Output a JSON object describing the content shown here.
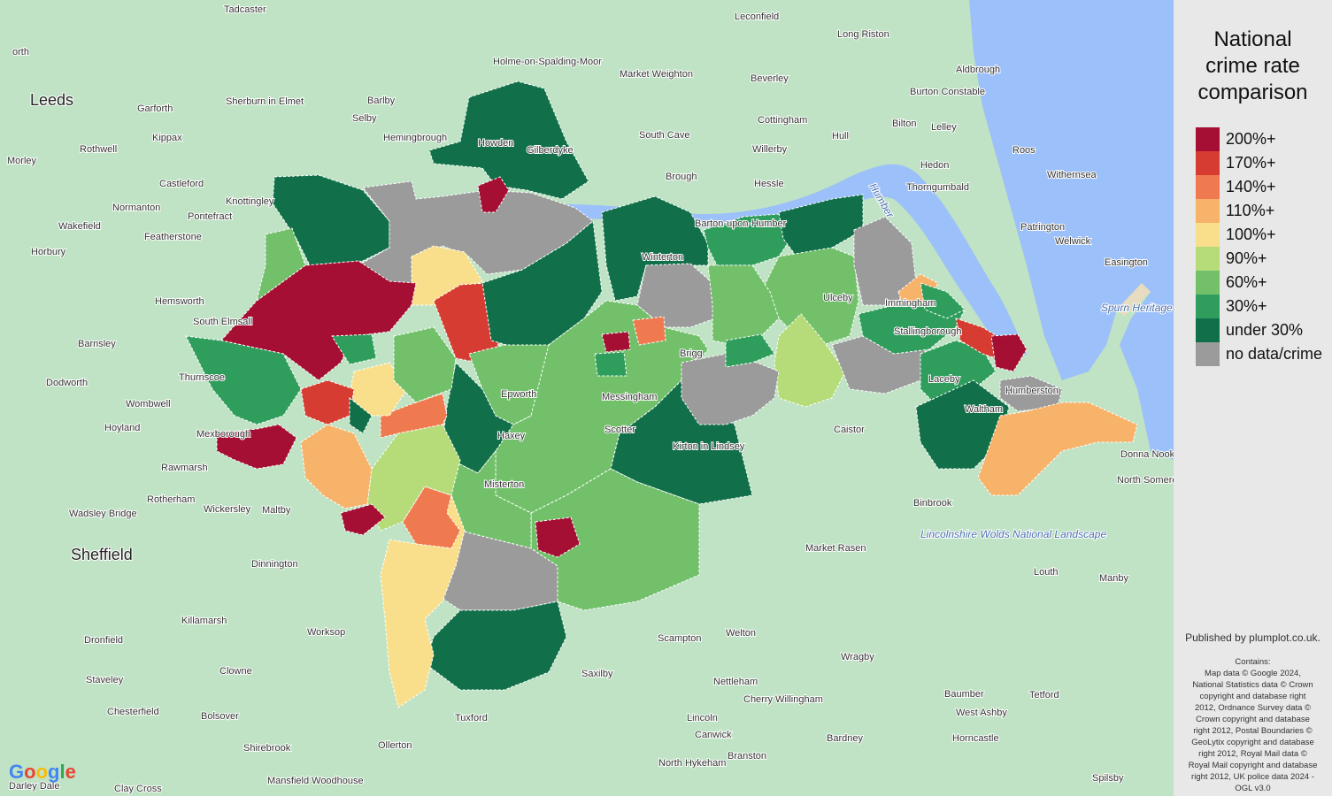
{
  "legend": {
    "title_lines": [
      "National",
      "crime rate",
      "comparison"
    ],
    "items": [
      {
        "label": "200%+",
        "color": "#a50f34"
      },
      {
        "label": "170%+",
        "color": "#d73c32"
      },
      {
        "label": "140%+",
        "color": "#f07a4f"
      },
      {
        "label": "110%+",
        "color": "#f8b36b"
      },
      {
        "label": "100%+",
        "color": "#f9df8c"
      },
      {
        "label": "90%+",
        "color": "#b5dc78"
      },
      {
        "label": "60%+",
        "color": "#73c06b"
      },
      {
        "label": "30%+",
        "color": "#2f9e5c"
      },
      {
        "label": "under 30%",
        "color": "#11704a"
      },
      {
        "label": "no data/crime",
        "color": "#9b9b9b"
      }
    ]
  },
  "attribution": {
    "published": "Published by plumplot.co.uk.",
    "contains_lines": [
      "Contains:",
      "Map data © Google 2024,",
      "National Statistics data © Crown",
      "copyright and database right",
      "2012, Ordnance Survey data ©",
      "Crown copyright and database",
      "right 2012, Postal Boundaries ©",
      "GeoLytix copyright and database",
      "right 2012, Royal Mail data ©",
      "Royal Mail copyright and database",
      "right 2012, UK police data 2024 -",
      "OGL v3.0"
    ]
  },
  "google_logo": [
    "G",
    "o",
    "o",
    "g",
    "l",
    "e"
  ],
  "colors": {
    "water": "#9cc0f9",
    "land": "#bfe3c4",
    "boundary": "#ffffff"
  },
  "map": {
    "cities": [
      "Leeds",
      "Sheffield"
    ],
    "places": [
      "Tadcaster",
      "Market Weighton",
      "Leconfield",
      "Long Riston",
      "Beverley",
      "Aldbrough",
      "Holme-on-Spalding-Moor",
      "Burton Constable",
      "Garforth",
      "Sherburn in Elmet",
      "Barlby",
      "Selby",
      "Cottingham",
      "Bilton",
      "Lelley",
      "Rothwell",
      "Kippax",
      "Hemingbrough",
      "South Cave",
      "Hull",
      "Willerby",
      "Hedon",
      "Roos",
      "Morley",
      "Castleford",
      "Howden",
      "Gilberdyke",
      "Brough",
      "Hessle",
      "Thorngumbald",
      "Withernsea",
      "Wakefield",
      "Normanton",
      "Knottingley",
      "Pontefract",
      "Featherstone",
      "Patrington",
      "Welwick",
      "Horbury",
      "Easington",
      "Hemsworth",
      "South Elmsall",
      "Barnsley",
      "Dodworth",
      "Thurnscoe",
      "Wombwell",
      "Hoyland",
      "Mexborough",
      "Rawmarsh",
      "Caistor",
      "Donna Nook",
      "North Somercotes",
      "Rotherham",
      "Wickersley",
      "Maltby",
      "Binbrook",
      "Wadsley Bridge",
      "Market Rasen",
      "Louth",
      "Dinnington",
      "Manby",
      "Killamarsh",
      "Worksop",
      "Scampton",
      "Welton",
      "Dronfield",
      "Clowne",
      "Wragby",
      "Staveley",
      "Saxilby",
      "Nettleham",
      "Cherry Willingham",
      "Baumber",
      "West Ashby",
      "Tetford",
      "Chesterfield",
      "Bolsover",
      "Tuxford",
      "Lincoln",
      "Canwick",
      "Horncastle",
      "Shirebrook",
      "Ollerton",
      "Bardney",
      "Branston",
      "North Hykeham",
      "Mansfield Woodhouse",
      "Clay Cross",
      "Darley Dale",
      "Spilsby",
      "Epworth",
      "Haxey",
      "Misterton",
      "Messingham",
      "Scotter",
      "Kirton in Lindsey",
      "Winterton",
      "Brigg",
      "Ulceby",
      "Stallingborough",
      "Laceby",
      "Waltham",
      "Humberston",
      "Immingham",
      "Barton-upon-Humber"
    ],
    "water_labels": [
      "Humber",
      "Spurn Heritage Coast",
      "Lincolnshire Wolds National Landscape"
    ]
  }
}
